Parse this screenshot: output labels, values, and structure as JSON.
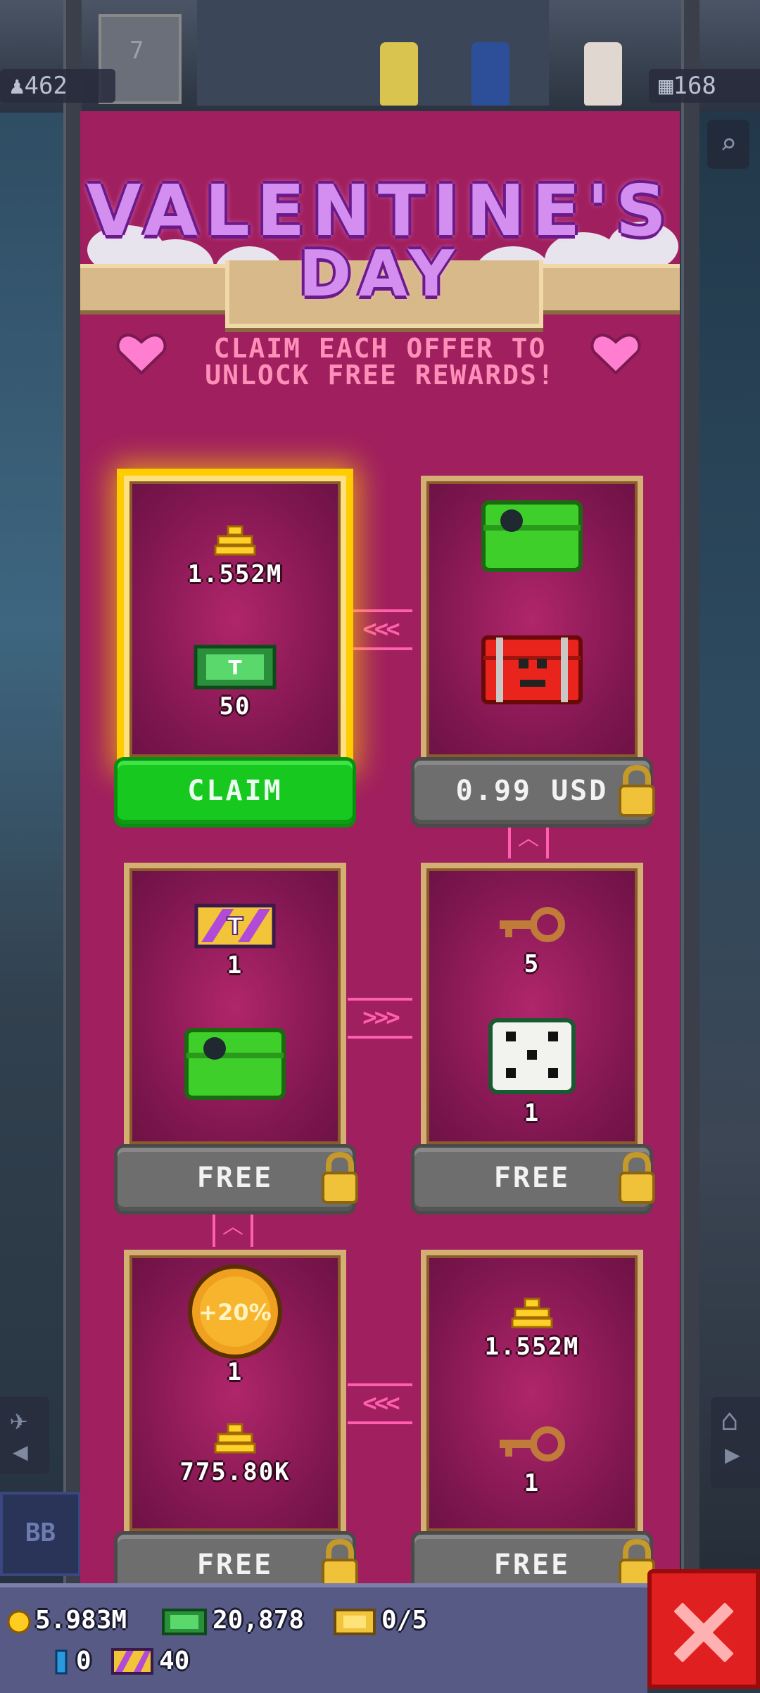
{
  "hud": {
    "population": "462",
    "floors": "168",
    "elevator_floor": "7"
  },
  "event": {
    "title_line1": "VALENTINE'S",
    "title_line2": "DAY",
    "subtitle_line1": "CLAIM EACH OFFER TO",
    "subtitle_line2": "UNLOCK FREE REWARDS!"
  },
  "offers": [
    {
      "state": "claim",
      "button": "CLAIM",
      "rewards": [
        {
          "icon": "coins-icon",
          "qty": "1.552M"
        },
        {
          "icon": "bux-icon",
          "qty": "50"
        }
      ]
    },
    {
      "state": "locked",
      "button": "0.99 USD",
      "rewards": [
        {
          "icon": "green-chest-icon",
          "qty": ""
        },
        {
          "icon": "red-chest-icon",
          "qty": ""
        }
      ]
    },
    {
      "state": "locked",
      "button": "FREE",
      "rewards": [
        {
          "icon": "golden-ticket-icon",
          "qty": "1"
        },
        {
          "icon": "green-chest-icon",
          "qty": ""
        }
      ]
    },
    {
      "state": "locked",
      "button": "FREE",
      "rewards": [
        {
          "icon": "key-icon",
          "qty": "5"
        },
        {
          "icon": "dice-icon",
          "qty": "1"
        }
      ]
    },
    {
      "state": "locked",
      "button": "FREE",
      "rewards": [
        {
          "icon": "boost-coin-icon",
          "label": "+20%",
          "qty": "1"
        },
        {
          "icon": "coins-icon",
          "qty": "775.80K"
        }
      ]
    },
    {
      "state": "locked",
      "button": "FREE",
      "rewards": [
        {
          "icon": "coins-icon",
          "qty": "1.552M"
        },
        {
          "icon": "key-icon",
          "qty": "1"
        }
      ]
    }
  ],
  "resources": {
    "coins": "5.983M",
    "bux": "20,878",
    "vip_tickets": "0/5",
    "blue_items": "0",
    "golden_tickets": "40"
  },
  "side": {
    "bb_label": "BB"
  },
  "colors": {
    "panel": "#a01f5e",
    "claim_green": "#17c81e",
    "locked_grey": "#6e6e6e",
    "close_red": "#e02020",
    "gold": "#ffcc00"
  }
}
